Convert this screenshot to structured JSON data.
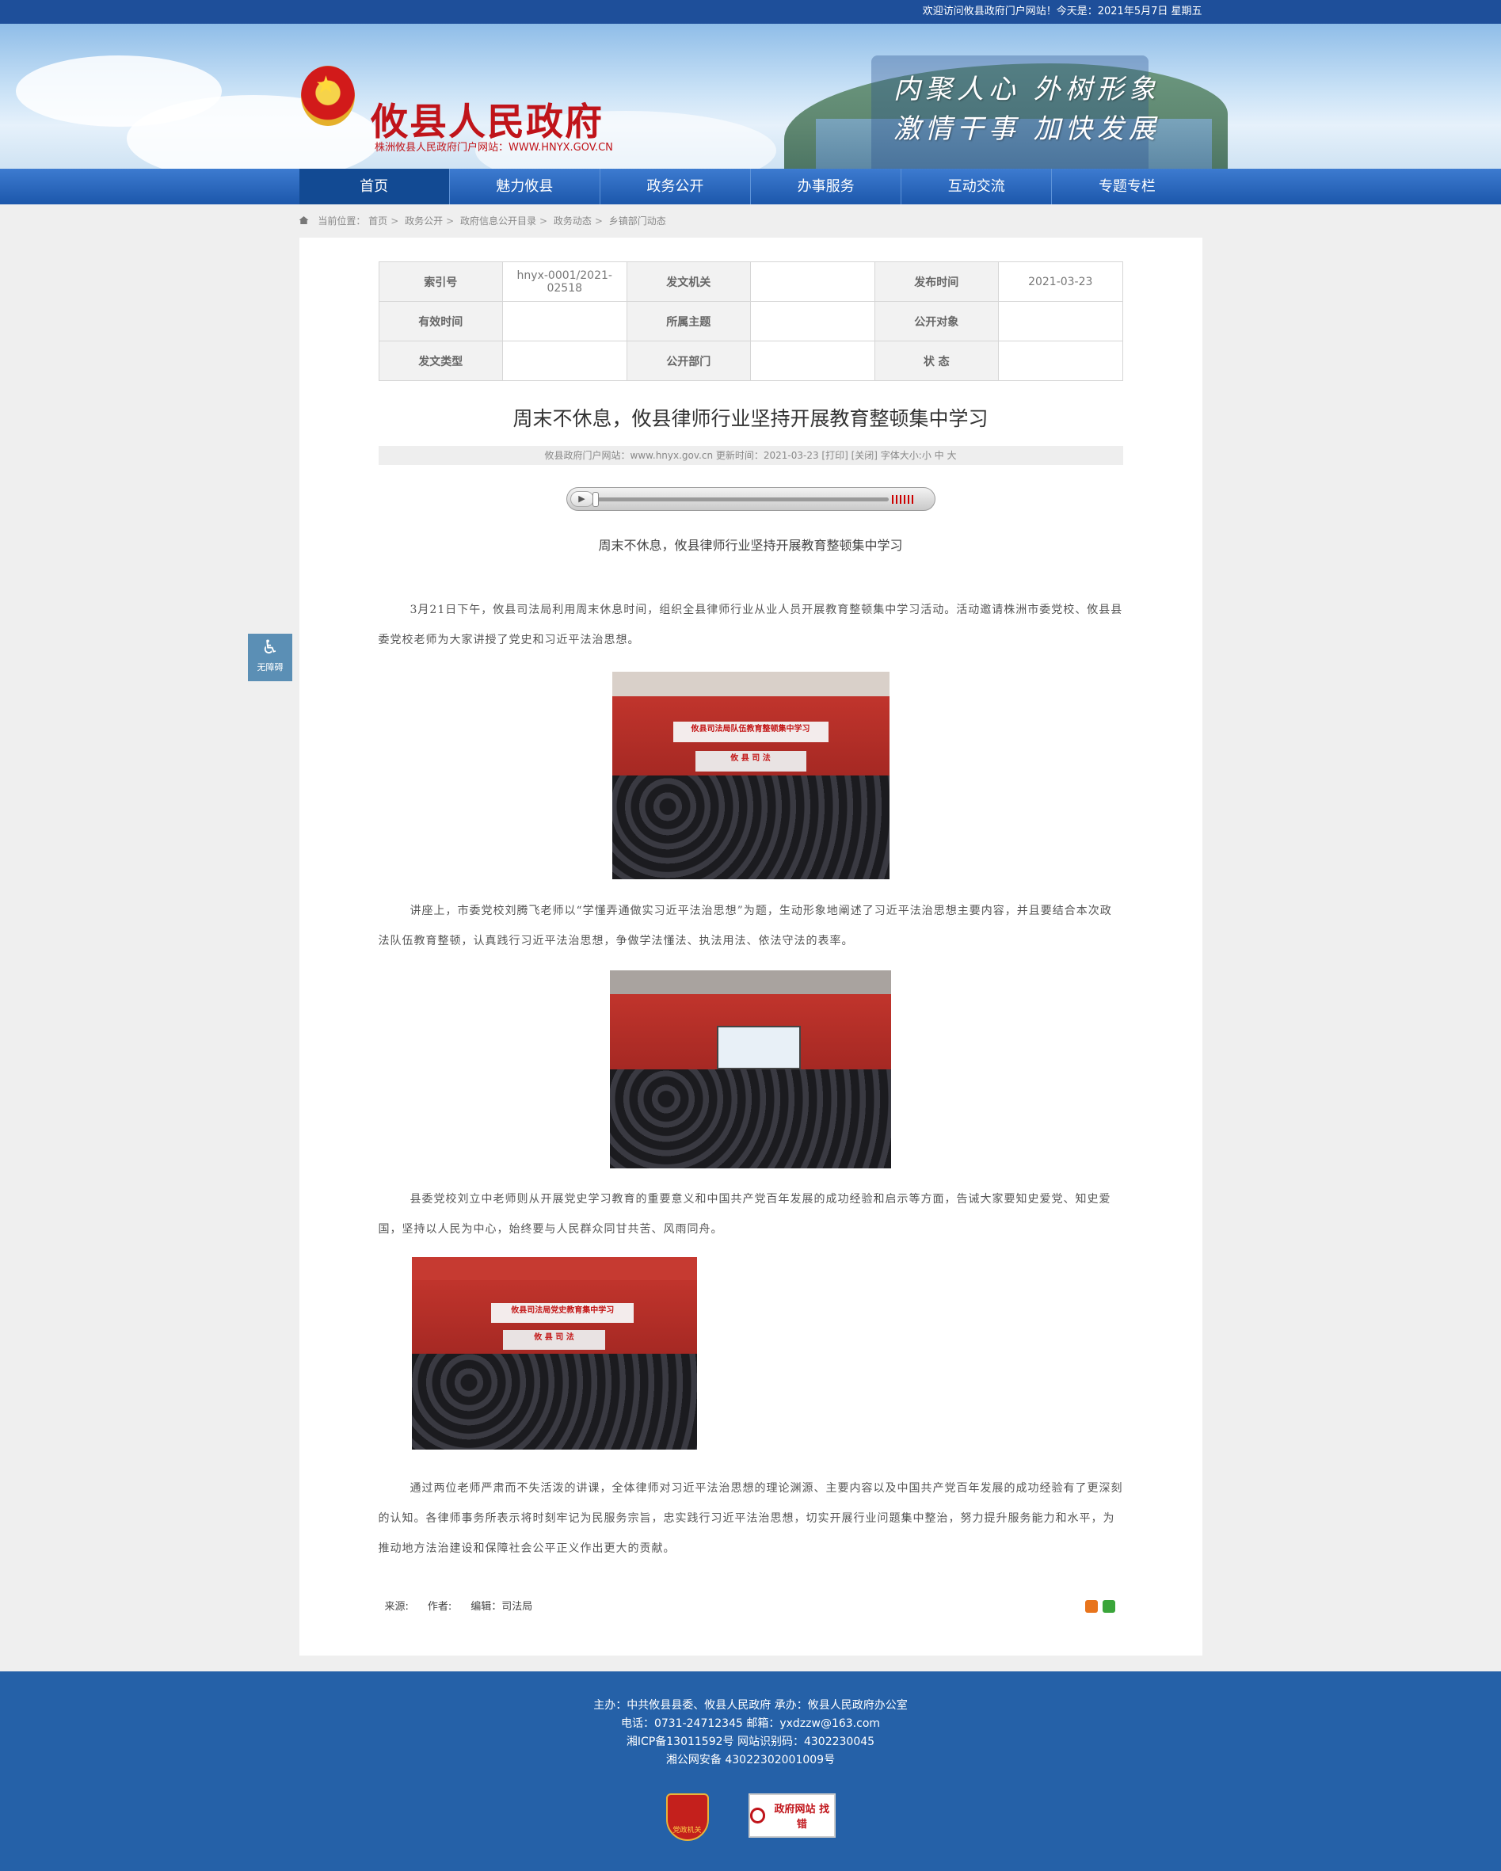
{
  "topbar": {
    "welcome": "欢迎访问攸县政府门户网站！今天是：2021年5月7日 星期五"
  },
  "header": {
    "site_name": "攸县人民政府",
    "site_subtitle": "株洲攸县人民政府门户网站：WWW.HNYX.GOV.CN",
    "slogan_line1": "内聚人心 外树形象",
    "slogan_line2": "激情干事 加快发展"
  },
  "nav": {
    "items": [
      {
        "label": "首页"
      },
      {
        "label": "魅力攸县"
      },
      {
        "label": "政务公开"
      },
      {
        "label": "办事服务"
      },
      {
        "label": "互动交流"
      },
      {
        "label": "专题专栏"
      }
    ]
  },
  "breadcrumb": {
    "prefix": "当前位置：",
    "items": [
      "首页",
      "政务公开",
      "政府信息公开目录",
      "政务动态",
      "乡镇部门动态"
    ]
  },
  "meta_table": {
    "rows": [
      [
        {
          "k": "索引号",
          "v": "hnyx-0001/2021-02518"
        },
        {
          "k": "发文机关",
          "v": ""
        },
        {
          "k": "发布时间",
          "v": "2021-03-23"
        }
      ],
      [
        {
          "k": "有效时间",
          "v": ""
        },
        {
          "k": "所属主题",
          "v": ""
        },
        {
          "k": "公开对象",
          "v": ""
        }
      ],
      [
        {
          "k": "发文类型",
          "v": ""
        },
        {
          "k": "公开部门",
          "v": ""
        },
        {
          "k": "状 态",
          "v": ""
        }
      ]
    ]
  },
  "article": {
    "title": "周末不休息，攸县律师行业坚持开展教育整顿集中学习",
    "meta": "攸县政府门户网站：www.hnyx.gov.cn  更新时间：2021-03-23  [打印] [关闭]  字体大小:小 中 大",
    "subtitle": "周末不休息，攸县律师行业坚持开展教育整顿集中学习",
    "paragraphs": [
      "3月21日下午，攸县司法局利用周末休息时间，组织全县律师行业从业人员开展教育整顿集中学习活动。活动邀请株洲市委党校、攸县县委党校老师为大家讲授了党史和习近平法治思想。",
      "讲座上，市委党校刘腾飞老师以“学懂弄通做实习近平法治思想”为题，生动形象地阐述了习近平法治思想主要内容，并且要结合本次政法队伍教育整顿，认真践行习近平法治思想，争做学法懂法、执法用法、依法守法的表率。",
      "县委党校刘立中老师则从开展党史学习教育的重要意义和中国共产党百年发展的成功经验和启示等方面，告诫大家要知史爱党、知史爱国，坚持以人民为中心，始终要与人民群众同甘共苦、风雨同舟。",
      "通过两位老师严肃而不失活泼的讲课，全体律师对习近平法治思想的理论渊源、主要内容以及中国共产党百年发展的成功经验有了更深刻的认知。各律师事务所表示将时刻牢记为民服务宗旨，忠实践行习近平法治思想，切实开展行业问题集中整治，努力提升服务能力和水平，为推动地方法治建设和保障社会公平正义作出更大的贡献。"
    ],
    "photo1_banner": "攸县司法局队伍教育整顿集中学习",
    "photo1_sign": "攸 县 司 法",
    "photo3_banner": "攸县司法局党史教育集中学习",
    "photo3_sign": "攸 县 司 法",
    "source_label": "来源:",
    "author_label": "作者:",
    "editor_label": "编辑：司法局"
  },
  "player": {
    "play_symbol": "▶"
  },
  "accessibility": {
    "label": "无障碍",
    "icon": "wheelchair-icon"
  },
  "footer": {
    "line1": "主办：中共攸县县委、攸县人民政府  承办：攸县人民政府办公室",
    "line2": "电话：0731-24712345  邮箱：yxdzzw@163.com",
    "line3": "湘ICP备13011592号    网站识别码：4302230045",
    "line4": "湘公网安备 43022302001009号",
    "badge_party": "党政机关",
    "badge_error": "政府网站 找错"
  },
  "colors": {
    "nav": "#1c57ab",
    "accent_red": "#c0141a",
    "footer": "#2561a8"
  }
}
